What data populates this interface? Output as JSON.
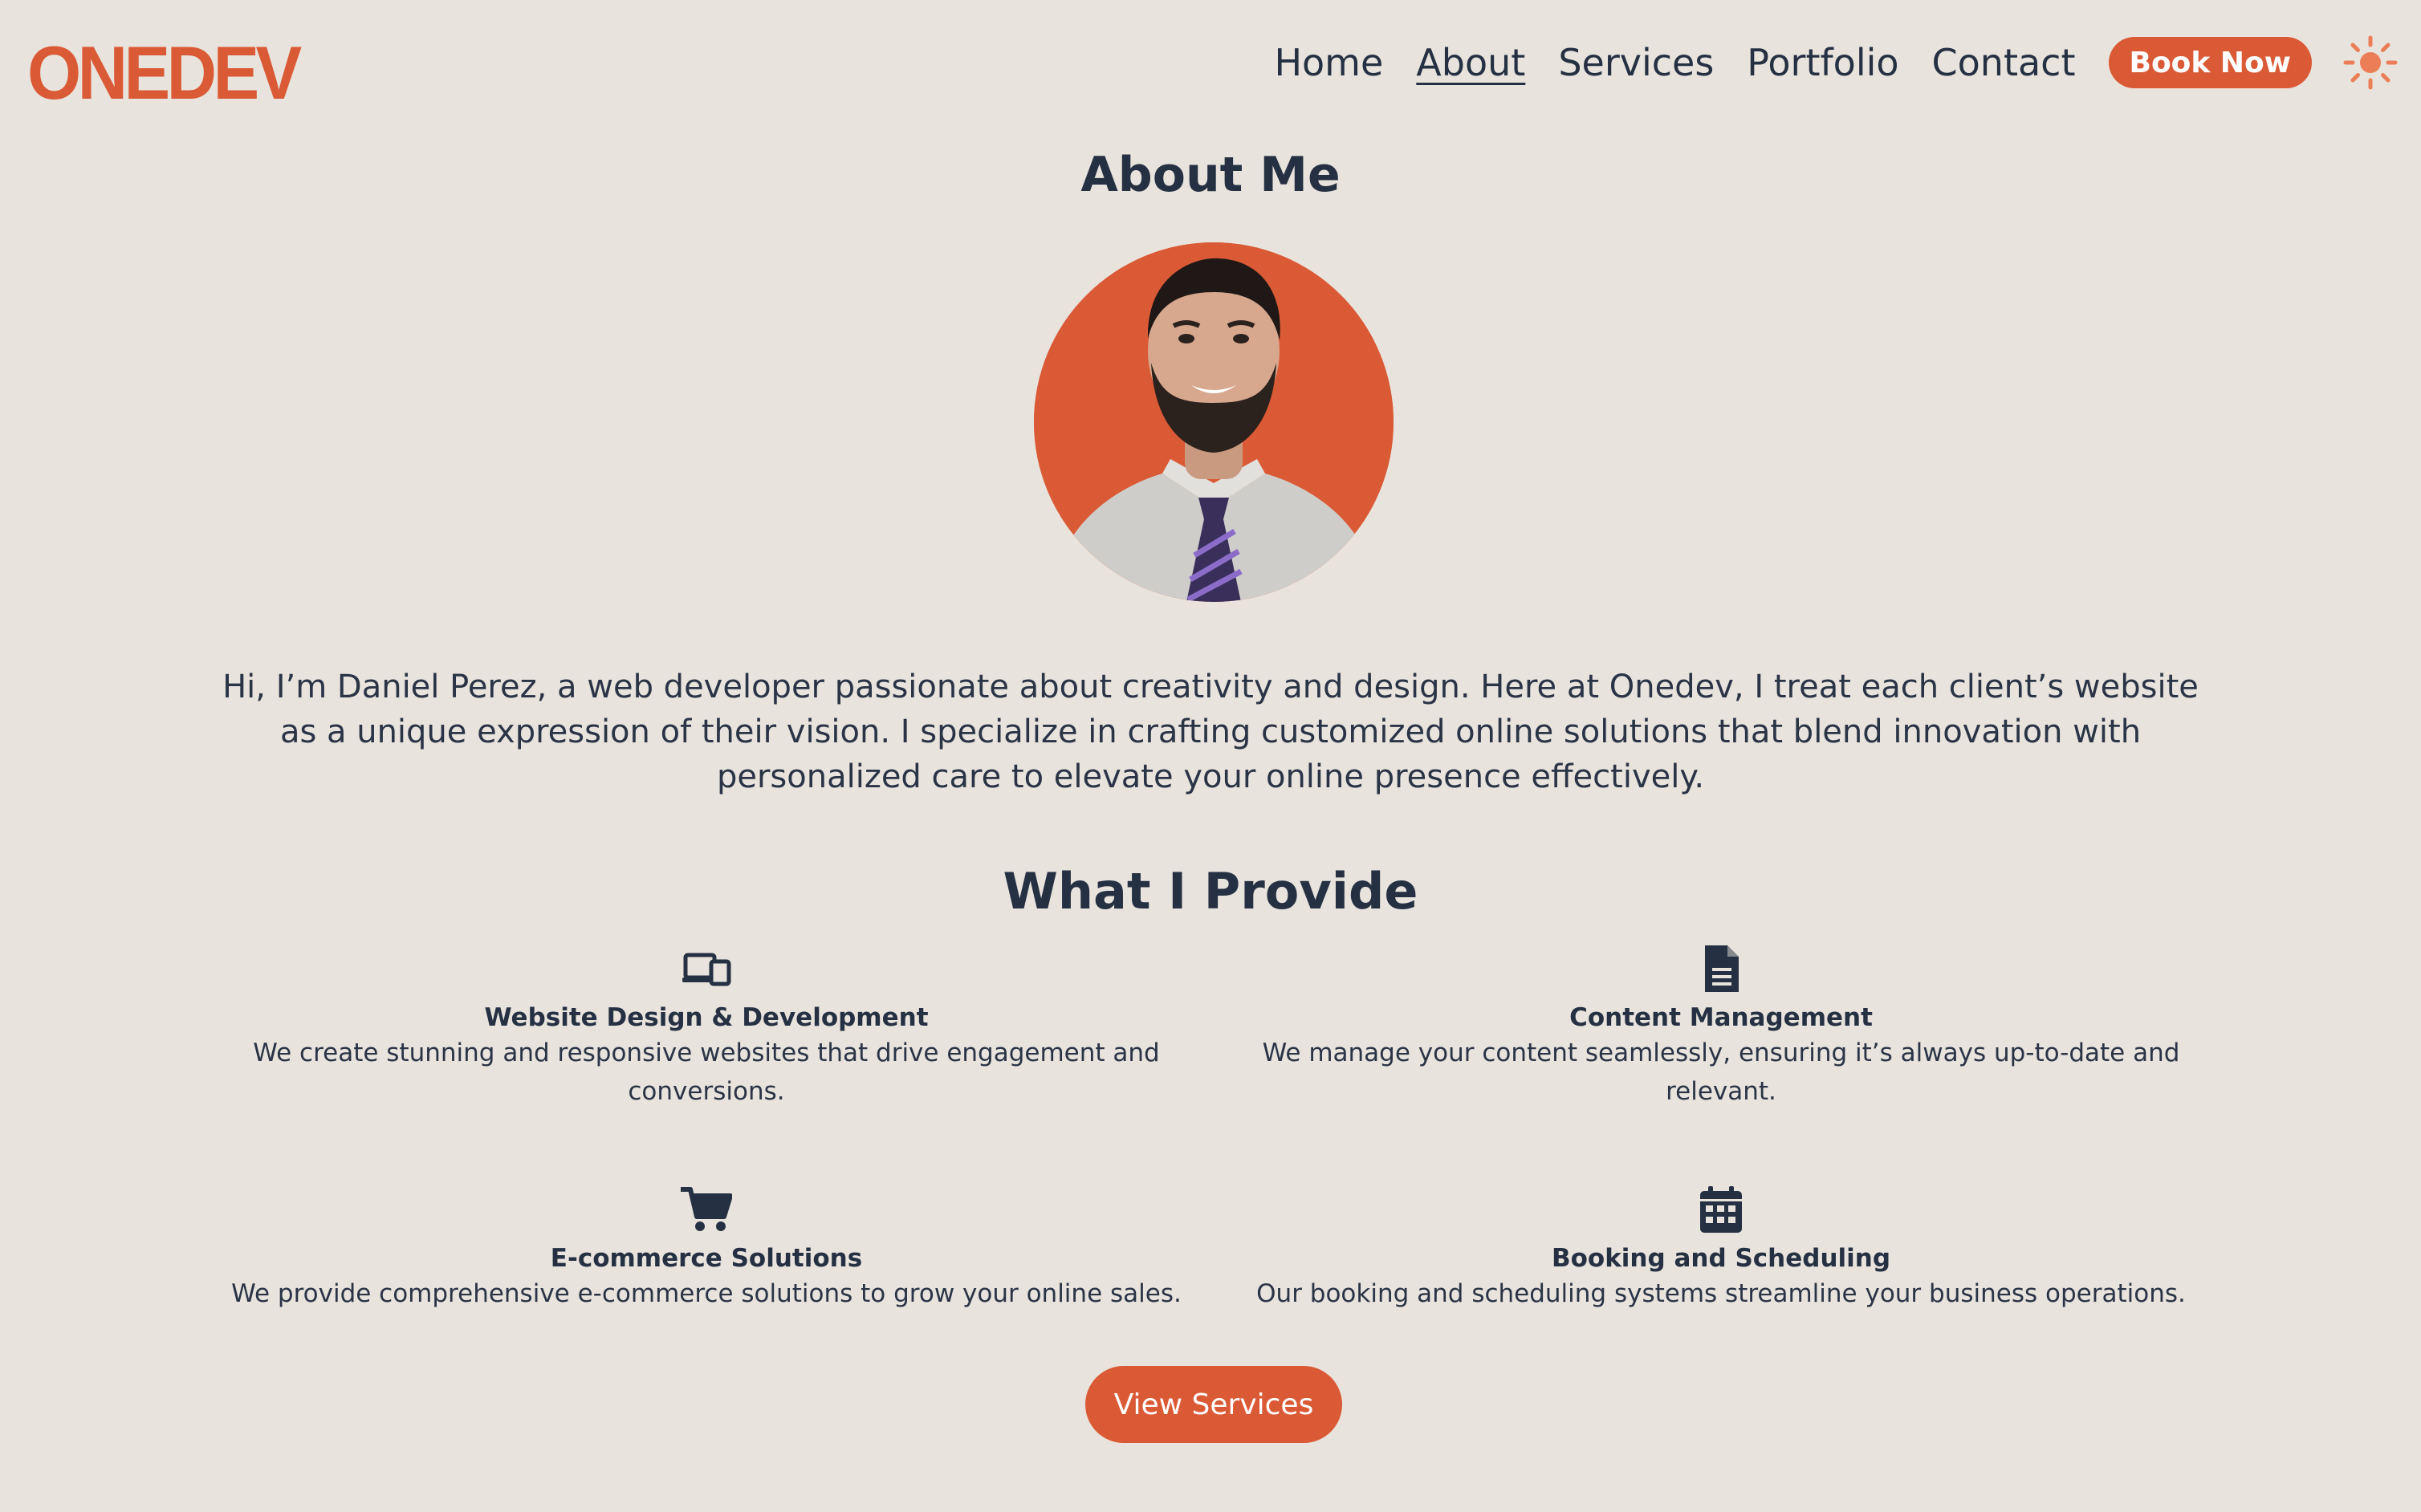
{
  "brand": {
    "logo_text": "ONEDEV",
    "accent": "#db5a36",
    "background": "#e8e3dc",
    "text_color": "#253043"
  },
  "nav": {
    "items": [
      {
        "label": "Home",
        "active": false
      },
      {
        "label": "About",
        "active": true
      },
      {
        "label": "Services",
        "active": false
      },
      {
        "label": "Portfolio",
        "active": false
      },
      {
        "label": "Contact",
        "active": false
      }
    ],
    "book_label": "Book Now",
    "theme_toggle_icon": "sun-icon"
  },
  "about": {
    "heading": "About Me",
    "avatar_icon": "profile-photo",
    "bio": "Hi, I’m Daniel Perez, a web developer passionate about creativity and design. Here at Onedev, I treat each client’s website as a unique expression of their vision. I specialize in crafting customized online solutions that blend innovation with personalized care to elevate your online presence effectively."
  },
  "provide": {
    "heading": "What I Provide",
    "items": [
      {
        "icon": "devices-icon",
        "title": "Website Design & Development",
        "desc": "We create stunning and responsive websites that drive engagement and conversions."
      },
      {
        "icon": "document-icon",
        "title": "Content Management",
        "desc": "We manage your content seamlessly, ensuring it’s always up-to-date and relevant."
      },
      {
        "icon": "cart-icon",
        "title": "E-commerce Solutions",
        "desc": "We provide comprehensive e-commerce solutions to grow your online sales."
      },
      {
        "icon": "calendar-icon",
        "title": "Booking and Scheduling",
        "desc": "Our booking and scheduling systems streamline your business operations."
      }
    ],
    "cta_label": "View Services"
  }
}
